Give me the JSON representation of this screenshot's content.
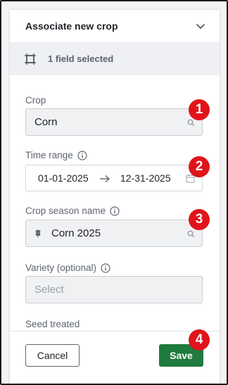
{
  "panel": {
    "title": "Associate new crop",
    "selection_text": "1 field selected"
  },
  "form": {
    "crop": {
      "label": "Crop",
      "value": "Corn"
    },
    "time_range": {
      "label": "Time range",
      "start": "01-01-2025",
      "end": "12-31-2025"
    },
    "crop_season": {
      "label": "Crop season name",
      "value": "Corn 2025"
    },
    "variety": {
      "label": "Variety (optional)",
      "placeholder": "Select"
    },
    "seed_treated": {
      "label": "Seed treated"
    }
  },
  "footer": {
    "cancel_label": "Cancel",
    "save_label": "Save"
  },
  "badges": [
    "1",
    "2",
    "3",
    "4"
  ],
  "colors": {
    "save_green": "#1f7a3d",
    "badge_red": "#e0141a",
    "selection_bg": "#eef0f3"
  },
  "icons": [
    "chevron-down-icon",
    "field-boundary-icon",
    "search-icon",
    "info-icon",
    "arrow-right-icon",
    "calendar-icon",
    "wheat-icon"
  ]
}
